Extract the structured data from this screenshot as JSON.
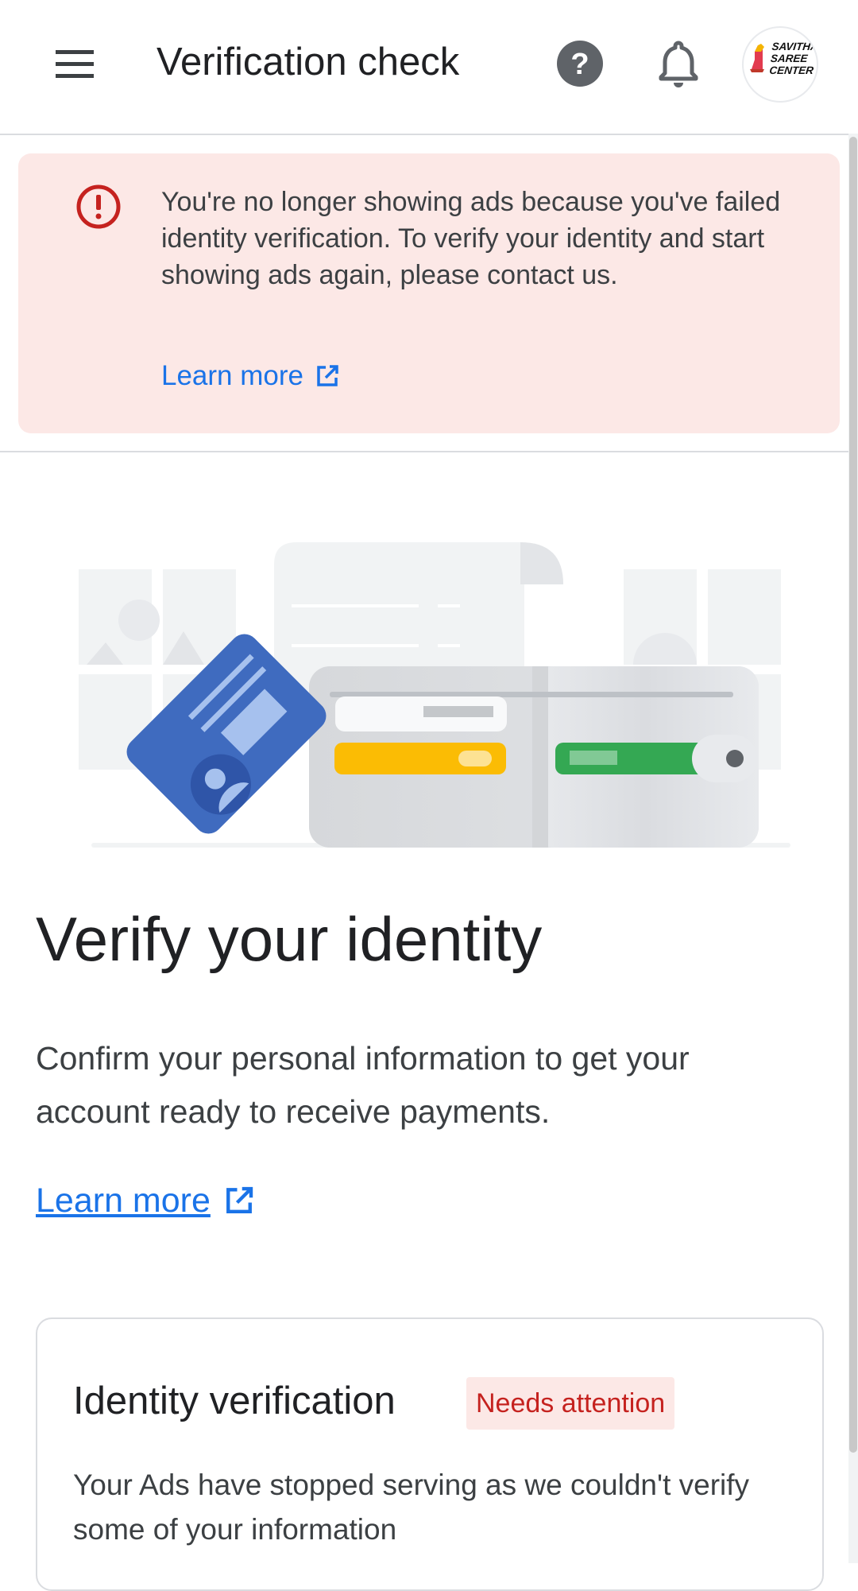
{
  "app_bar": {
    "title": "Verification check",
    "menu_icon": "menu-icon",
    "help_icon": "help-icon",
    "notifications_icon": "bell-icon",
    "avatar_logo_lines": [
      "SAVITHA",
      "SAREE",
      "CENTER"
    ]
  },
  "alert": {
    "icon": "error-icon",
    "message": "You're no longer showing ads because you've failed identity verification. To verify your identity and start showing ads again, please contact us.",
    "link_label": "Learn more",
    "link_icon": "open-in-new-icon"
  },
  "hero": {
    "illustration": "id-card-and-wallet-illustration",
    "title": "Verify your identity",
    "body": "Confirm your personal information to get your account ready to receive payments.",
    "link_label": "Learn more",
    "link_icon": "open-in-new-icon"
  },
  "card": {
    "title": "Identity verification",
    "badge": "Needs attention",
    "body": "Your Ads have stopped serving as we couldn't verify some of your information"
  },
  "colors": {
    "link_blue": "#1a73e8",
    "alert_background": "#fce8e6",
    "error_red": "#c5221f"
  }
}
